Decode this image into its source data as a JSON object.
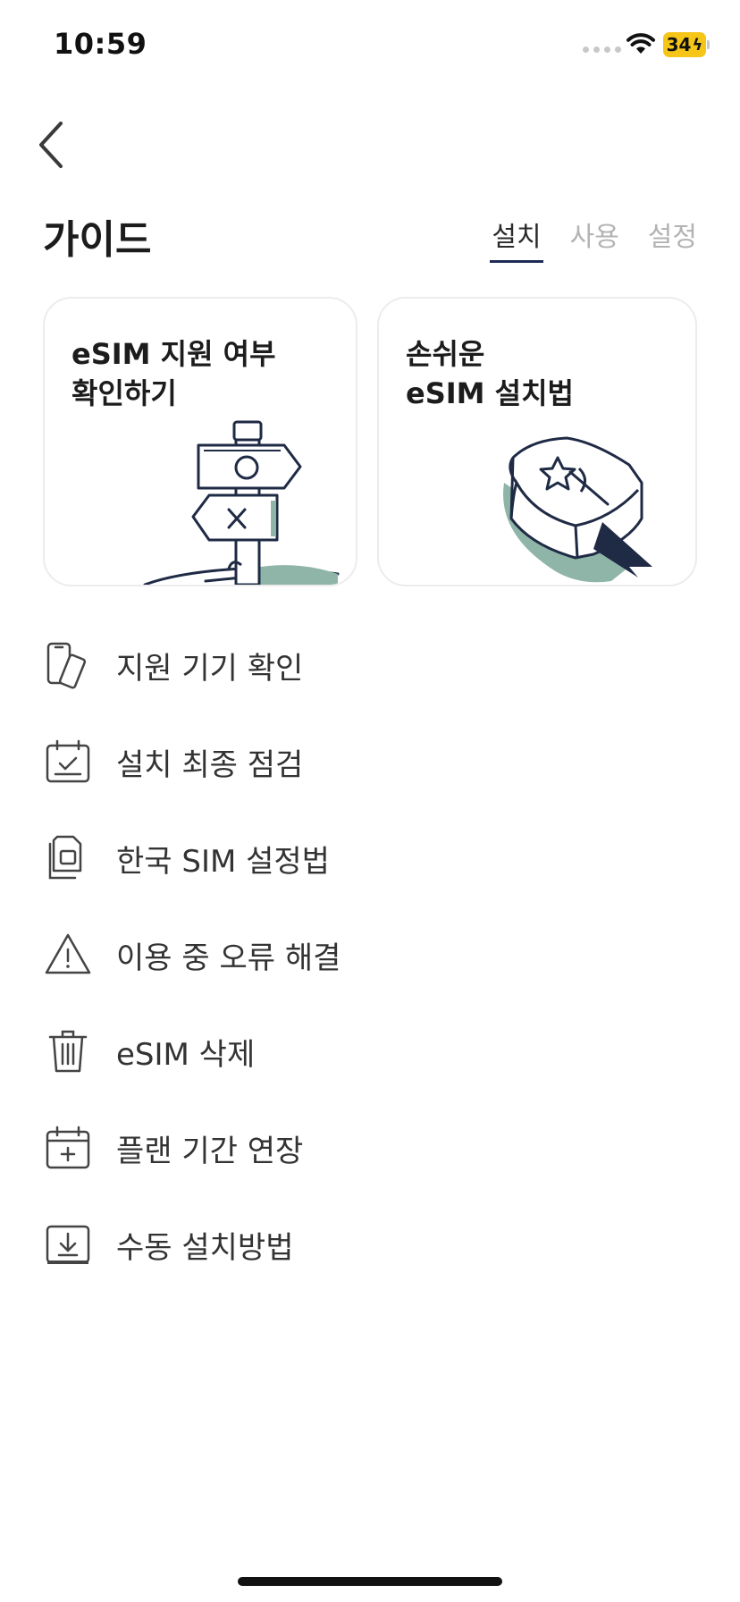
{
  "status_bar": {
    "time": "10:59",
    "battery_percent": "34"
  },
  "header": {
    "title": "가이드",
    "tabs": [
      {
        "label": "설치",
        "active": true
      },
      {
        "label": "사용",
        "active": false
      },
      {
        "label": "설정",
        "active": false
      }
    ]
  },
  "cards": [
    {
      "title": "eSIM 지원 여부\n확인하기",
      "icon": "signpost-illustration"
    },
    {
      "title": "손쉬운\neSIM 설치법",
      "icon": "guide-book-illustration"
    }
  ],
  "menu": [
    {
      "label": "지원 기기 확인",
      "icon": "devices-icon"
    },
    {
      "label": "설치 최종 점검",
      "icon": "calendar-check-icon"
    },
    {
      "label": "한국 SIM 설정법",
      "icon": "sim-card-icon"
    },
    {
      "label": "이용 중 오류 해결",
      "icon": "warning-icon"
    },
    {
      "label": "eSIM 삭제",
      "icon": "trash-icon"
    },
    {
      "label": "플랜 기간 연장",
      "icon": "calendar-plus-icon"
    },
    {
      "label": "수동 설치방법",
      "icon": "download-tray-icon"
    }
  ],
  "colors": {
    "accent_underline": "#1f2a55",
    "illustration_stroke": "#1f2a45",
    "illustration_fill": "#8fb5a8",
    "battery": "#f5c518"
  }
}
